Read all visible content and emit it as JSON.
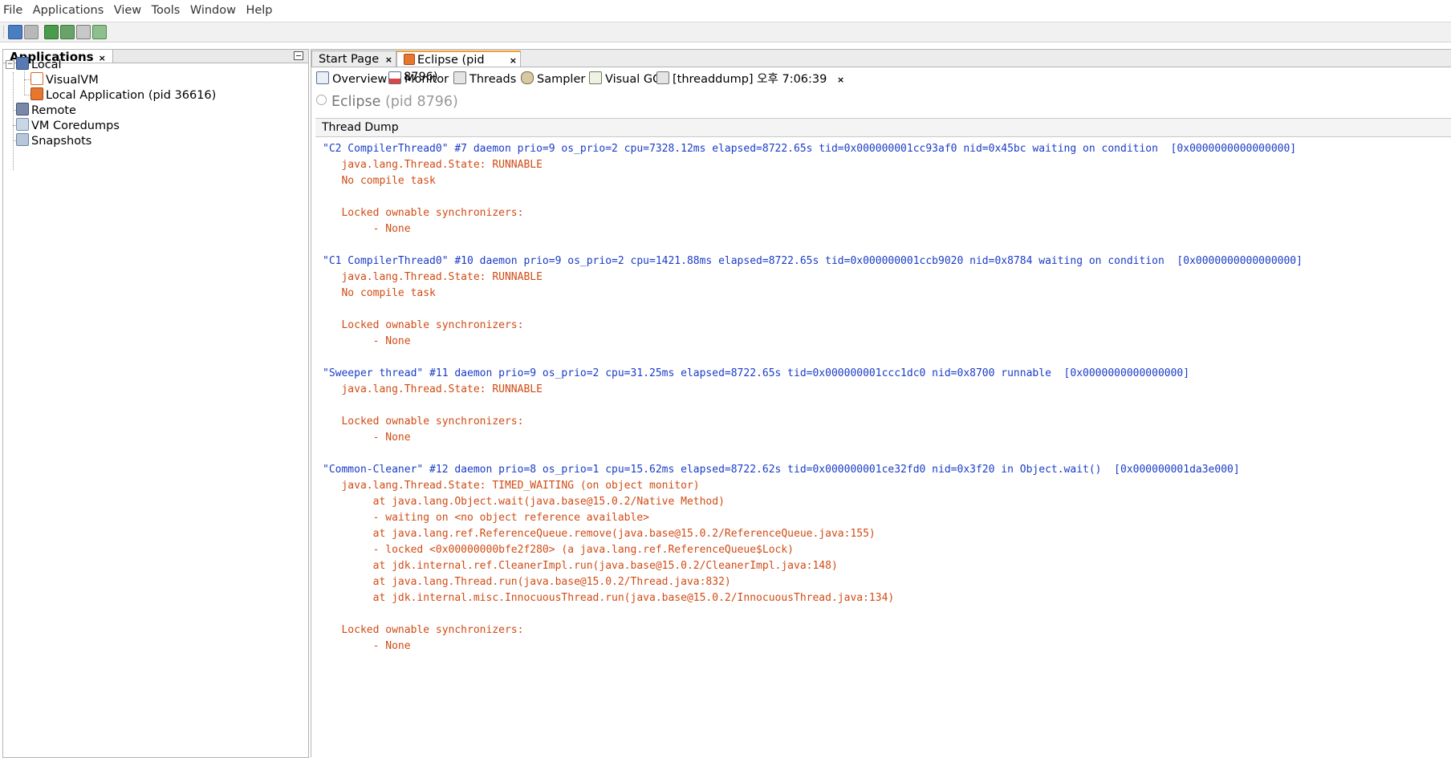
{
  "menu": [
    "File",
    "Applications",
    "View",
    "Tools",
    "Window",
    "Help"
  ],
  "toolbar_icons": [
    "load-snapshot-icon",
    "save-icon",
    "add-jmx-connection-icon",
    "heap-dump-icon",
    "thread-dump-icon",
    "profiler-snapshot-icon"
  ],
  "left_panel": {
    "title": "Applications",
    "close": "×",
    "tree": {
      "local": "Local",
      "visualvm": "VisualVM",
      "local_app": "Local Application (pid 36616)",
      "remote": "Remote",
      "coredumps": "VM Coredumps",
      "snapshots": "Snapshots"
    }
  },
  "doc_tabs": {
    "start": "Start Page",
    "eclipse": "Eclipse (pid 8796)",
    "close": "×"
  },
  "sub_tabs": {
    "overview": "Overview",
    "monitor": "Monitor",
    "threads": "Threads",
    "sampler": "Sampler",
    "visualgc": "Visual GC",
    "threaddump": "[threaddump] 오후 7:06:39",
    "close": "×"
  },
  "process": {
    "name": "Eclipse",
    "pid": "(pid 8796)"
  },
  "section_title": "Thread Dump",
  "dump_lines": [
    {
      "t": "\"C2 CompilerThread0\" #7 daemon prio=9 os_prio=2 cpu=7328.12ms elapsed=8722.65s tid=0x000000001cc93af0 nid=0x45bc waiting on condition  [0x0000000000000000]",
      "k": "head"
    },
    {
      "t": "   java.lang.Thread.State: RUNNABLE",
      "k": "body"
    },
    {
      "t": "   No compile task",
      "k": "body"
    },
    {
      "t": "",
      "k": "body"
    },
    {
      "t": "   Locked ownable synchronizers:",
      "k": "body"
    },
    {
      "t": "        - None",
      "k": "body"
    },
    {
      "t": "",
      "k": "body"
    },
    {
      "t": "\"C1 CompilerThread0\" #10 daemon prio=9 os_prio=2 cpu=1421.88ms elapsed=8722.65s tid=0x000000001ccb9020 nid=0x8784 waiting on condition  [0x0000000000000000]",
      "k": "head"
    },
    {
      "t": "   java.lang.Thread.State: RUNNABLE",
      "k": "body"
    },
    {
      "t": "   No compile task",
      "k": "body"
    },
    {
      "t": "",
      "k": "body"
    },
    {
      "t": "   Locked ownable synchronizers:",
      "k": "body"
    },
    {
      "t": "        - None",
      "k": "body"
    },
    {
      "t": "",
      "k": "body"
    },
    {
      "t": "\"Sweeper thread\" #11 daemon prio=9 os_prio=2 cpu=31.25ms elapsed=8722.65s tid=0x000000001ccc1dc0 nid=0x8700 runnable  [0x0000000000000000]",
      "k": "head"
    },
    {
      "t": "   java.lang.Thread.State: RUNNABLE",
      "k": "body"
    },
    {
      "t": "",
      "k": "body"
    },
    {
      "t": "   Locked ownable synchronizers:",
      "k": "body"
    },
    {
      "t": "        - None",
      "k": "body"
    },
    {
      "t": "",
      "k": "body"
    },
    {
      "t": "\"Common-Cleaner\" #12 daemon prio=8 os_prio=1 cpu=15.62ms elapsed=8722.62s tid=0x000000001ce32fd0 nid=0x3f20 in Object.wait()  [0x000000001da3e000]",
      "k": "head"
    },
    {
      "t": "   java.lang.Thread.State: TIMED_WAITING (on object monitor)",
      "k": "body"
    },
    {
      "t": "        at java.lang.Object.wait(java.base@15.0.2/Native Method)",
      "k": "body"
    },
    {
      "t": "        - waiting on <no object reference available>",
      "k": "body"
    },
    {
      "t": "        at java.lang.ref.ReferenceQueue.remove(java.base@15.0.2/ReferenceQueue.java:155)",
      "k": "body"
    },
    {
      "t": "        - locked <0x00000000bfe2f280> (a java.lang.ref.ReferenceQueue$Lock)",
      "k": "body"
    },
    {
      "t": "        at jdk.internal.ref.CleanerImpl.run(java.base@15.0.2/CleanerImpl.java:148)",
      "k": "body"
    },
    {
      "t": "        at java.lang.Thread.run(java.base@15.0.2/Thread.java:832)",
      "k": "body"
    },
    {
      "t": "        at jdk.internal.misc.InnocuousThread.run(java.base@15.0.2/InnocuousThread.java:134)",
      "k": "body"
    },
    {
      "t": "",
      "k": "body"
    },
    {
      "t": "   Locked ownable synchronizers:",
      "k": "body"
    },
    {
      "t": "        - None",
      "k": "body"
    }
  ],
  "colors": {
    "thread_header": "#1a3cc8",
    "thread_body": "#d14b14",
    "active_tab_accent": "#f0a030"
  }
}
